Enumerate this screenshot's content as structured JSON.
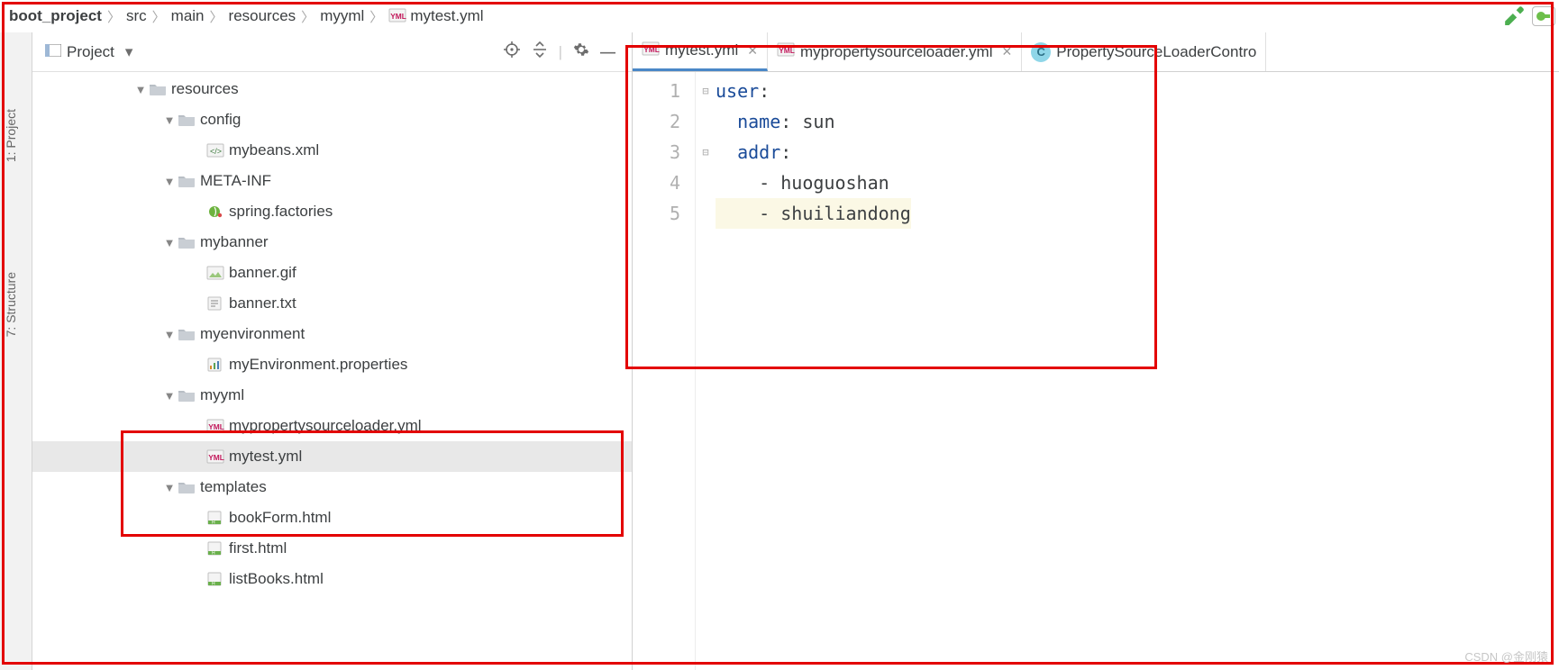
{
  "breadcrumbs": {
    "items": [
      {
        "label": "boot_project",
        "bold": true
      },
      {
        "label": "src"
      },
      {
        "label": "main"
      },
      {
        "label": "resources"
      },
      {
        "label": "myyml"
      },
      {
        "label": "mytest.yml",
        "icon": "yml"
      }
    ]
  },
  "side_tabs": {
    "a": "1: Project",
    "b": "7: Structure"
  },
  "project_panel": {
    "title": "Project"
  },
  "tree": [
    {
      "depth": 0,
      "twisty": "down",
      "icon": "folder",
      "label": "resources"
    },
    {
      "depth": 1,
      "twisty": "down",
      "icon": "folder",
      "label": "config"
    },
    {
      "depth": 2,
      "twisty": "",
      "icon": "xml",
      "label": "mybeans.xml"
    },
    {
      "depth": 1,
      "twisty": "down",
      "icon": "folder",
      "label": "META-INF"
    },
    {
      "depth": 2,
      "twisty": "",
      "icon": "spring",
      "label": "spring.factories"
    },
    {
      "depth": 1,
      "twisty": "down",
      "icon": "folder",
      "label": "mybanner"
    },
    {
      "depth": 2,
      "twisty": "",
      "icon": "img",
      "label": "banner.gif"
    },
    {
      "depth": 2,
      "twisty": "",
      "icon": "txt",
      "label": "banner.txt"
    },
    {
      "depth": 1,
      "twisty": "down",
      "icon": "folder",
      "label": "myenvironment"
    },
    {
      "depth": 2,
      "twisty": "",
      "icon": "prop",
      "label": "myEnvironment.properties"
    },
    {
      "depth": 1,
      "twisty": "down",
      "icon": "folder",
      "label": "myyml"
    },
    {
      "depth": 2,
      "twisty": "",
      "icon": "yml",
      "label": "mypropertysourceloader.yml"
    },
    {
      "depth": 2,
      "twisty": "",
      "icon": "yml",
      "label": "mytest.yml",
      "selected": true
    },
    {
      "depth": 1,
      "twisty": "down",
      "icon": "folder",
      "label": "templates"
    },
    {
      "depth": 2,
      "twisty": "",
      "icon": "html",
      "label": "bookForm.html"
    },
    {
      "depth": 2,
      "twisty": "",
      "icon": "html",
      "label": "first.html"
    },
    {
      "depth": 2,
      "twisty": "",
      "icon": "html",
      "label": "listBooks.html"
    }
  ],
  "editor_tabs": [
    {
      "label": "mytest.yml",
      "icon": "yml",
      "active": true,
      "closable": true
    },
    {
      "label": "mypropertysourceloader.yml",
      "icon": "yml",
      "active": false,
      "closable": true
    },
    {
      "label": "PropertySourceLoaderContro",
      "icon": "class",
      "active": false,
      "closable": false
    }
  ],
  "code": {
    "lines": [
      {
        "n": "1",
        "kind": "key",
        "indent": "",
        "key": "user",
        "after": ":",
        "fold": "-"
      },
      {
        "n": "2",
        "kind": "kv",
        "indent": "  ",
        "key": "name",
        "after": ": ",
        "val": "sun"
      },
      {
        "n": "3",
        "kind": "key",
        "indent": "  ",
        "key": "addr",
        "after": ":",
        "fold": "-"
      },
      {
        "n": "4",
        "kind": "li",
        "indent": "    ",
        "val": "- huoguoshan"
      },
      {
        "n": "5",
        "kind": "li",
        "indent": "    ",
        "val": "- shuiliandong",
        "hl": true
      }
    ]
  },
  "watermark": "CSDN @金刚猿"
}
